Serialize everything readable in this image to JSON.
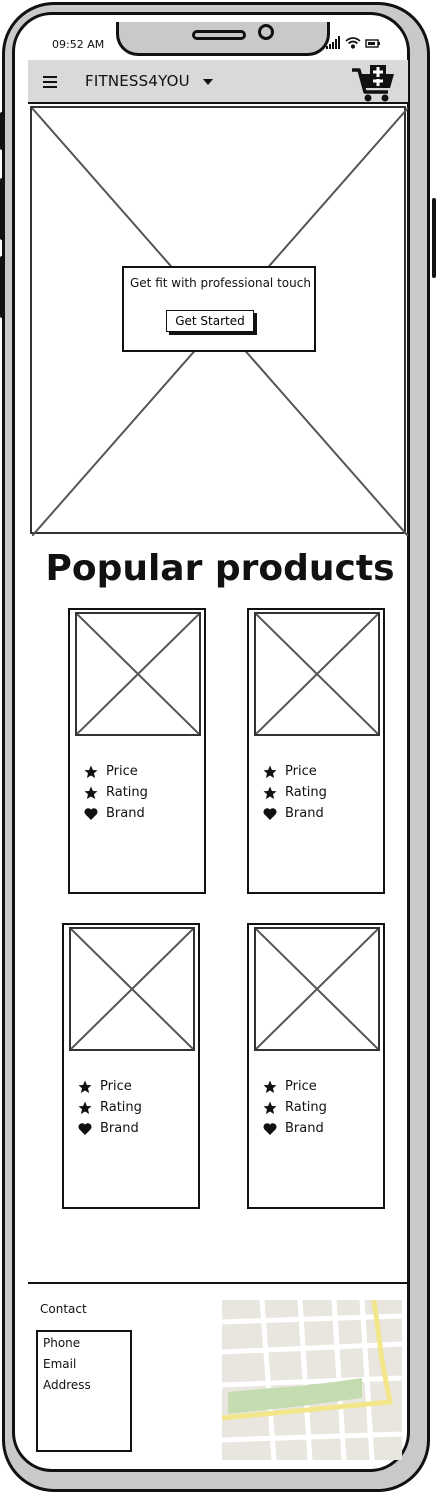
{
  "status_bar": {
    "time": "09:52 AM"
  },
  "navbar": {
    "brand": "FITNESS4YOU",
    "menu_icon": "hamburger-icon",
    "dropdown_icon": "caret-down-icon",
    "cart_icon": "cart-plus-icon"
  },
  "hero": {
    "tagline": "Get fit with professional touch",
    "cta_label": "Get Started"
  },
  "products": {
    "title": "Popular products",
    "items": [
      {
        "price_label": "Price",
        "rating_label": "Rating",
        "brand_label": "Brand"
      },
      {
        "price_label": "Price",
        "rating_label": "Rating",
        "brand_label": "Brand"
      },
      {
        "price_label": "Price",
        "rating_label": "Rating",
        "brand_label": "Brand"
      },
      {
        "price_label": "Price",
        "rating_label": "Rating",
        "brand_label": "Brand"
      }
    ]
  },
  "footer": {
    "contact_title": "Contact",
    "contact_items": [
      "Phone",
      "Email",
      "Address"
    ]
  },
  "colors": {
    "frame": "#c9c9c9",
    "navbar": "#d9d9d9",
    "map_bg": "#e9e6df",
    "map_park": "#c5dbb0",
    "map_road_major": "#f3e58a"
  }
}
